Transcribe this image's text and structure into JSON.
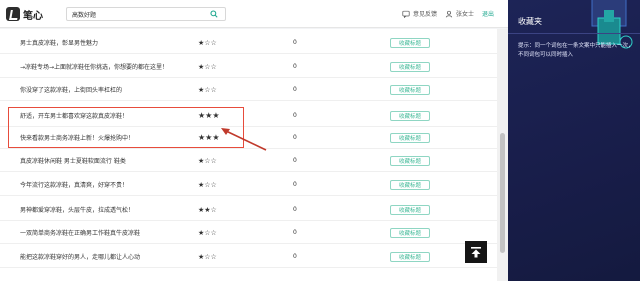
{
  "header": {
    "logo_text": "笔心",
    "search_value": "高数好题",
    "feedback_label": "意见反馈",
    "user_label": "张女士",
    "logout_label": "退出"
  },
  "rows": [
    {
      "title": "男士真皮凉鞋，彰显男性魅力",
      "stars": "★☆☆",
      "count": "0",
      "button": "收藏标题"
    },
    {
      "title": "→凉鞋专场→上面就凉鞋任你挑选，你想要的都在这里！",
      "stars": "★☆☆",
      "count": "0",
      "button": "收藏标题"
    },
    {
      "title": "你没穿了这款凉鞋，上街回头率杠杠的",
      "stars": "★☆☆",
      "count": "0",
      "button": "收藏标题"
    },
    {
      "title": "舒适，开车男士都喜欢穿这款真皮凉鞋！",
      "stars": "★★★",
      "count": "0",
      "button": "收藏标题"
    },
    {
      "title": "快来看款男士商务凉鞋上新！火爆抢购中！",
      "stars": "★★★",
      "count": "0",
      "button": "收藏标题"
    },
    {
      "title": "真皮凉鞋休闲鞋 男士夏鞋软面流行 鞋类",
      "stars": "★☆☆",
      "count": "0",
      "button": "收藏标题"
    },
    {
      "title": "今年流行这款凉鞋，真清爽，好穿不贵！",
      "stars": "★☆☆",
      "count": "0",
      "button": "收藏标题"
    },
    {
      "title": "男神都爱穿凉鞋，头层牛皮，拉成透气松！",
      "stars": "★★☆",
      "count": "0",
      "button": "收藏标题"
    },
    {
      "title": "一双简单商务凉鞋在正确男工作鞋真牛皮凉鞋",
      "stars": "★☆☆",
      "count": "0",
      "button": "收藏标题"
    },
    {
      "title": "能把这款凉鞋穿好的男人，走哪儿都让人心动",
      "stars": "★☆☆",
      "count": "0",
      "button": "收藏标题"
    }
  ],
  "sidebar": {
    "title": "收藏夹",
    "tip": "提示：同一个词包在一条文案中只能插入一次，不同词包可以同时插入"
  }
}
